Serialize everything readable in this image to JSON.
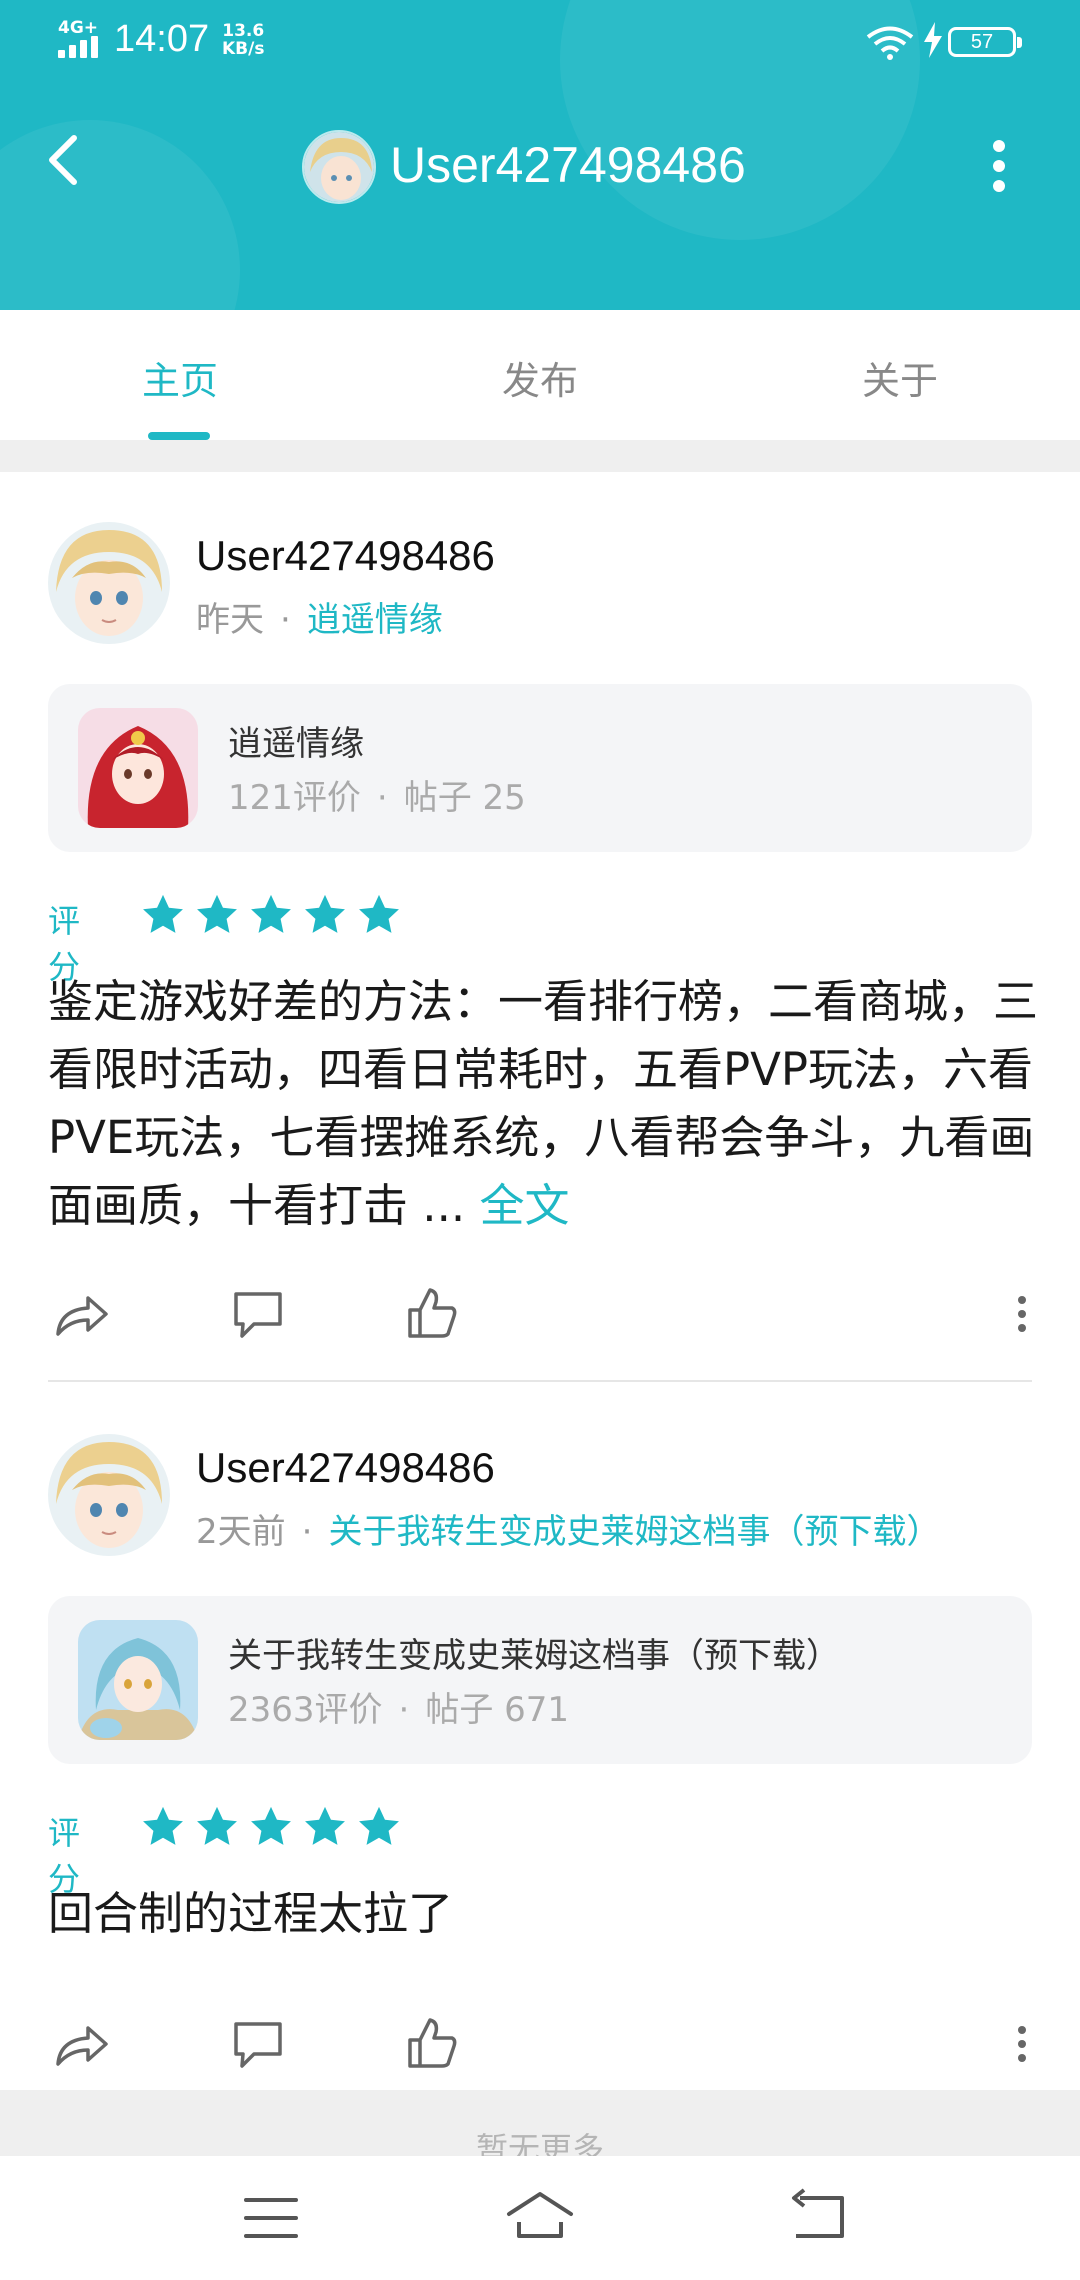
{
  "status": {
    "network": "4G+",
    "time": "14:07",
    "speed_value": "13.6",
    "speed_unit": "KB/s",
    "battery": "57"
  },
  "header": {
    "title": "User427498486",
    "back_icon": "chevron-left-icon",
    "more_icon": "more-vertical-icon"
  },
  "tabs": [
    {
      "label": "主页",
      "active": true
    },
    {
      "label": "发布",
      "active": false
    },
    {
      "label": "关于",
      "active": false
    }
  ],
  "posts": [
    {
      "author": "User427498486",
      "time": "昨天",
      "game_link": "逍遥情缘",
      "game": {
        "name": "逍遥情缘",
        "reviews": "121评价",
        "posts": "帖子 25"
      },
      "rating_label": "评分",
      "stars": 5,
      "body": "鉴定游戏好差的方法：一看排行榜，二看商城，三看限时活动，四看日常耗时，五看PVP玩法，六看PVE玩法，七看摆摊系统，八看帮会争斗，九看画面画质，十看打击 ...",
      "more_link": " 全文"
    },
    {
      "author": "User427498486",
      "time": "2天前",
      "game_link": "关于我转生变成史莱姆这档事（预下载）",
      "game": {
        "name": "关于我转生变成史莱姆这档事（预下载）",
        "reviews": "2363评价",
        "posts": "帖子 671"
      },
      "rating_label": "评分",
      "stars": 5,
      "body": "回合制的过程太拉了"
    }
  ],
  "footer": {
    "text": "暂无更多"
  },
  "colors": {
    "accent": "#1fb8c5",
    "header_bg": "#1fb8c5",
    "star": "#1fb8c5"
  }
}
